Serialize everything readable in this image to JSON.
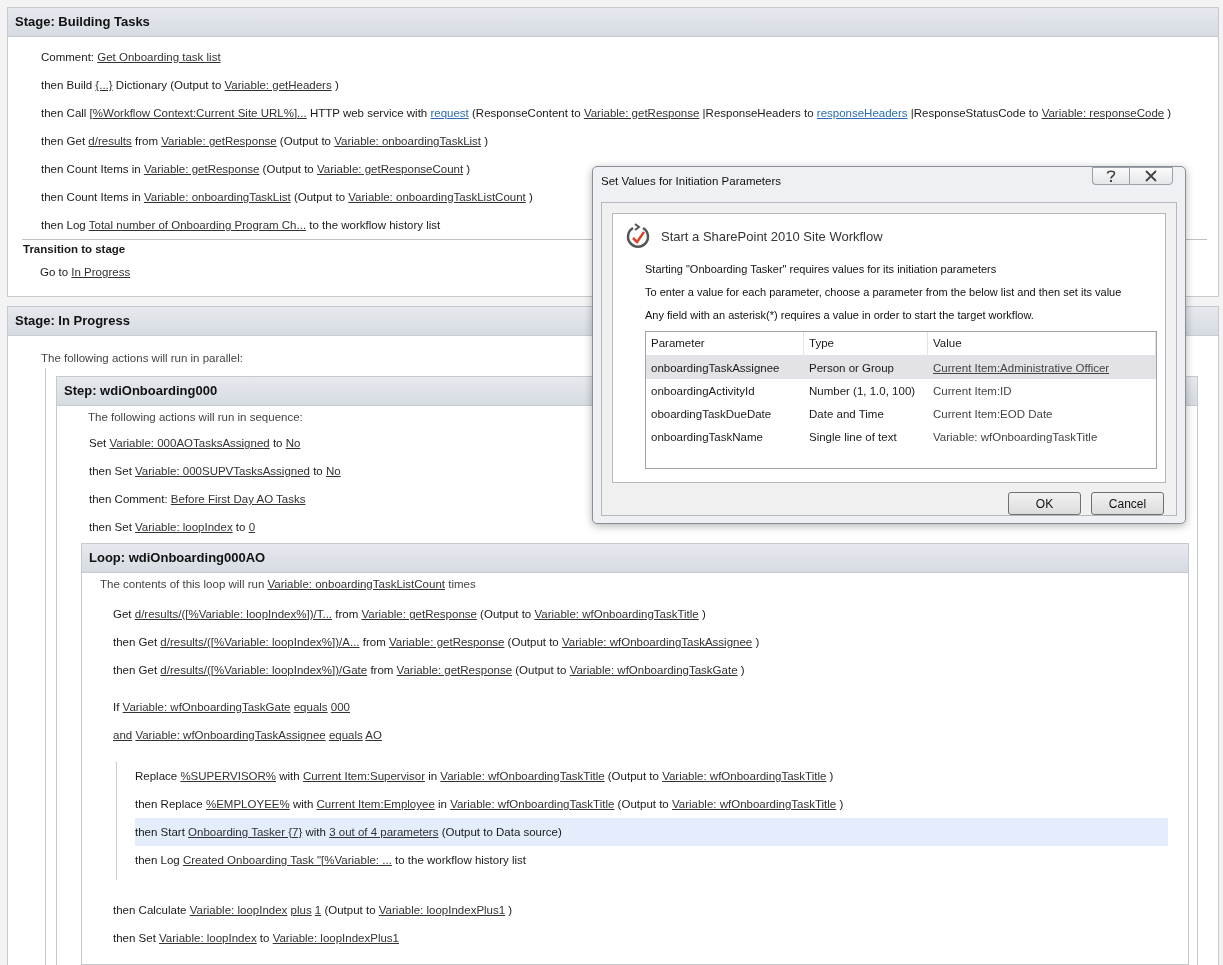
{
  "stages": [
    {
      "title": "Stage: Building Tasks",
      "actions": [
        {
          "parts": [
            {
              "text": "Comment: ",
              "kind": "text"
            },
            {
              "text": "Get Onboarding task list",
              "kind": "link"
            }
          ]
        },
        {
          "parts": [
            {
              "text": "then Build ",
              "kind": "text"
            },
            {
              "text": "{...}",
              "kind": "link"
            },
            {
              "text": " Dictionary (Output to ",
              "kind": "text"
            },
            {
              "text": "Variable: getHeaders",
              "kind": "link"
            },
            {
              "text": " )",
              "kind": "text"
            }
          ]
        },
        {
          "parts": [
            {
              "text": "then Call ",
              "kind": "text"
            },
            {
              "text": "[%Workflow Context:Current Site URL%]...",
              "kind": "link"
            },
            {
              "text": " HTTP web service with ",
              "kind": "text"
            },
            {
              "text": "request",
              "kind": "blue"
            },
            {
              "text": " (ResponseContent to ",
              "kind": "text"
            },
            {
              "text": "Variable: getResponse",
              "kind": "link"
            },
            {
              "text": " |ResponseHeaders to ",
              "kind": "text"
            },
            {
              "text": "responseHeaders",
              "kind": "blue"
            },
            {
              "text": " |ResponseStatusCode to ",
              "kind": "text"
            },
            {
              "text": "Variable: responseCode",
              "kind": "link"
            },
            {
              "text": " )",
              "kind": "text"
            }
          ]
        },
        {
          "parts": [
            {
              "text": "then Get ",
              "kind": "text"
            },
            {
              "text": "d/results",
              "kind": "link"
            },
            {
              "text": " from ",
              "kind": "text"
            },
            {
              "text": "Variable: getResponse",
              "kind": "link"
            },
            {
              "text": " (Output to ",
              "kind": "text"
            },
            {
              "text": "Variable: onboardingTaskList",
              "kind": "link"
            },
            {
              "text": " )",
              "kind": "text"
            }
          ]
        },
        {
          "parts": [
            {
              "text": "then Count Items in ",
              "kind": "text"
            },
            {
              "text": "Variable: getResponse",
              "kind": "link"
            },
            {
              "text": " (Output to ",
              "kind": "text"
            },
            {
              "text": "Variable: getResponseCount",
              "kind": "link"
            },
            {
              "text": " )",
              "kind": "text"
            }
          ]
        },
        {
          "parts": [
            {
              "text": "then Count Items in ",
              "kind": "text"
            },
            {
              "text": "Variable: onboardingTaskList",
              "kind": "link"
            },
            {
              "text": " (Output to ",
              "kind": "text"
            },
            {
              "text": "Variable: onboardingTaskListCount",
              "kind": "link"
            },
            {
              "text": " )",
              "kind": "text"
            }
          ]
        },
        {
          "parts": [
            {
              "text": "then Log ",
              "kind": "text"
            },
            {
              "text": "Total number of Onboarding Program Ch...",
              "kind": "link"
            },
            {
              "text": " to the workflow history list",
              "kind": "text"
            }
          ]
        }
      ],
      "transition": {
        "heading": "Transition to stage",
        "actions": [
          {
            "parts": [
              {
                "text": "Go to ",
                "kind": "text"
              },
              {
                "text": "In Progress",
                "kind": "link"
              }
            ]
          }
        ]
      }
    },
    {
      "title": "Stage: In Progress",
      "intro": "The following actions will run in parallel:",
      "step": {
        "title": "Step: wdiOnboarding000",
        "intro": "The following actions will run in sequence:",
        "actions": [
          {
            "parts": [
              {
                "text": "Set ",
                "kind": "text"
              },
              {
                "text": "Variable: 000AOTasksAssigned",
                "kind": "link"
              },
              {
                "text": " to ",
                "kind": "text"
              },
              {
                "text": "No",
                "kind": "link"
              }
            ]
          },
          {
            "parts": [
              {
                "text": "then Set ",
                "kind": "text"
              },
              {
                "text": "Variable: 000SUPVTasksAssigned",
                "kind": "link"
              },
              {
                "text": " to ",
                "kind": "text"
              },
              {
                "text": "No",
                "kind": "link"
              }
            ]
          },
          {
            "parts": [
              {
                "text": "then Comment: ",
                "kind": "text"
              },
              {
                "text": "Before First Day AO Tasks",
                "kind": "link"
              }
            ]
          },
          {
            "parts": [
              {
                "text": "then Set ",
                "kind": "text"
              },
              {
                "text": "Variable: loopIndex",
                "kind": "link"
              },
              {
                "text": " to ",
                "kind": "text"
              },
              {
                "text": "0",
                "kind": "link"
              }
            ]
          }
        ],
        "loop": {
          "title": "Loop: wdiOnboarding000AO",
          "intro": {
            "parts": [
              {
                "text": "The contents of this loop will run ",
                "kind": "text"
              },
              {
                "text": "Variable: onboardingTaskListCount",
                "kind": "link"
              },
              {
                "text": " times",
                "kind": "text"
              }
            ]
          },
          "actions": [
            {
              "parts": [
                {
                  "text": "Get ",
                  "kind": "text"
                },
                {
                  "text": "d/results/([%Variable: loopIndex%])/T...",
                  "kind": "link"
                },
                {
                  "text": " from ",
                  "kind": "text"
                },
                {
                  "text": "Variable: getResponse",
                  "kind": "link"
                },
                {
                  "text": " (Output to ",
                  "kind": "text"
                },
                {
                  "text": "Variable: wfOnboardingTaskTitle",
                  "kind": "link"
                },
                {
                  "text": " )",
                  "kind": "text"
                }
              ]
            },
            {
              "parts": [
                {
                  "text": "then Get ",
                  "kind": "text"
                },
                {
                  "text": "d/results/([%Variable: loopIndex%])/A...",
                  "kind": "link"
                },
                {
                  "text": " from ",
                  "kind": "text"
                },
                {
                  "text": "Variable: getResponse",
                  "kind": "link"
                },
                {
                  "text": " (Output to ",
                  "kind": "text"
                },
                {
                  "text": "Variable: wfOnboardingTaskAssignee",
                  "kind": "link"
                },
                {
                  "text": " )",
                  "kind": "text"
                }
              ]
            },
            {
              "parts": [
                {
                  "text": "then Get ",
                  "kind": "text"
                },
                {
                  "text": "d/results/([%Variable: loopIndex%])/Gate",
                  "kind": "link"
                },
                {
                  "text": " from ",
                  "kind": "text"
                },
                {
                  "text": "Variable: getResponse",
                  "kind": "link"
                },
                {
                  "text": " (Output to ",
                  "kind": "text"
                },
                {
                  "text": "Variable: wfOnboardingTaskGate",
                  "kind": "link"
                },
                {
                  "text": " )",
                  "kind": "text"
                }
              ]
            }
          ],
          "condition": [
            {
              "parts": [
                {
                  "text": "If ",
                  "kind": "text"
                },
                {
                  "text": "Variable: wfOnboardingTaskGate",
                  "kind": "link"
                },
                {
                  "text": "equals",
                  "kind": "link"
                },
                {
                  "text": "000",
                  "kind": "link"
                }
              ]
            },
            {
              "parts": [
                {
                  "text": "and",
                  "kind": "link"
                },
                {
                  "text": "Variable: wfOnboardingTaskAssignee",
                  "kind": "link"
                },
                {
                  "text": "equals",
                  "kind": "link"
                },
                {
                  "text": "AO",
                  "kind": "link"
                }
              ]
            }
          ],
          "branch": [
            {
              "selected": false,
              "parts": [
                {
                  "text": "Replace ",
                  "kind": "text"
                },
                {
                  "text": "%SUPERVISOR%",
                  "kind": "link"
                },
                {
                  "text": " with ",
                  "kind": "text"
                },
                {
                  "text": "Current Item:Supervisor",
                  "kind": "link"
                },
                {
                  "text": " in ",
                  "kind": "text"
                },
                {
                  "text": "Variable: wfOnboardingTaskTitle",
                  "kind": "link"
                },
                {
                  "text": " (Output to ",
                  "kind": "text"
                },
                {
                  "text": "Variable: wfOnboardingTaskTitle",
                  "kind": "link"
                },
                {
                  "text": " )",
                  "kind": "text"
                }
              ]
            },
            {
              "selected": false,
              "parts": [
                {
                  "text": "then Replace ",
                  "kind": "text"
                },
                {
                  "text": "%EMPLOYEE%",
                  "kind": "link"
                },
                {
                  "text": " with ",
                  "kind": "text"
                },
                {
                  "text": "Current Item:Employee",
                  "kind": "link"
                },
                {
                  "text": " in ",
                  "kind": "text"
                },
                {
                  "text": "Variable: wfOnboardingTaskTitle",
                  "kind": "link"
                },
                {
                  "text": " (Output to ",
                  "kind": "text"
                },
                {
                  "text": "Variable: wfOnboardingTaskTitle",
                  "kind": "link"
                },
                {
                  "text": " )",
                  "kind": "text"
                }
              ]
            },
            {
              "selected": true,
              "parts": [
                {
                  "text": "then Start ",
                  "kind": "text"
                },
                {
                  "text": "Onboarding Tasker {7}",
                  "kind": "link"
                },
                {
                  "text": " with ",
                  "kind": "text"
                },
                {
                  "text": "3 out of 4 parameters",
                  "kind": "link"
                },
                {
                  "text": " (Output to Data source)",
                  "kind": "text"
                }
              ]
            },
            {
              "selected": false,
              "parts": [
                {
                  "text": "then Log ",
                  "kind": "text"
                },
                {
                  "text": "Created Onboarding Task \"[%Variable: ...",
                  "kind": "link"
                },
                {
                  "text": " to the workflow history list",
                  "kind": "text"
                }
              ]
            }
          ],
          "after": [
            {
              "parts": [
                {
                  "text": "then Calculate ",
                  "kind": "text"
                },
                {
                  "text": "Variable: loopIndex",
                  "kind": "link"
                },
                {
                  "text": "plus",
                  "kind": "link"
                },
                {
                  "text": "1",
                  "kind": "link"
                },
                {
                  "text": " (Output to ",
                  "kind": "text"
                },
                {
                  "text": "Variable: loopIndexPlus1",
                  "kind": "link"
                },
                {
                  "text": " )",
                  "kind": "text"
                }
              ]
            },
            {
              "parts": [
                {
                  "text": "then Set ",
                  "kind": "text"
                },
                {
                  "text": "Variable: loopIndex",
                  "kind": "link"
                },
                {
                  "text": " to ",
                  "kind": "text"
                },
                {
                  "text": "Variable: loopIndexPlus1",
                  "kind": "link"
                }
              ]
            }
          ]
        }
      }
    }
  ],
  "dialog": {
    "title": "Set Values for Initiation Parameters",
    "heading": "Start a SharePoint 2010 Site Workflow",
    "messages": [
      "Starting \"Onboarding Tasker\" requires values for its initiation parameters",
      "To enter a value for each parameter, choose a parameter from the below list and then set its value",
      "Any field with an asterisk(*) requires a value in order to start the target workflow."
    ],
    "columns": [
      "Parameter",
      "Type",
      "Value"
    ],
    "rows": [
      {
        "parameter": "onboardingTaskAssignee",
        "type": "Person or Group",
        "value": "Current Item:Administrative Officer",
        "linked": true,
        "selected": true
      },
      {
        "parameter": "onboardingActivityId",
        "type": "Number (1, 1.0, 100)",
        "value": "Current Item:ID",
        "linked": false,
        "selected": false
      },
      {
        "parameter": "oboardingTaskDueDate",
        "type": "Date and Time",
        "value": "Current Item:EOD Date",
        "linked": false,
        "selected": false
      },
      {
        "parameter": "onboardingTaskName",
        "type": "Single line of text",
        "value": "Variable: wfOnboardingTaskTitle",
        "linked": false,
        "selected": false
      }
    ],
    "buttons": [
      "OK",
      "Cancel"
    ]
  }
}
